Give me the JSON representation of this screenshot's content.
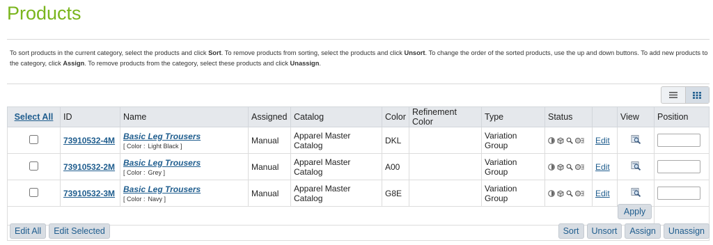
{
  "page_title": "Products",
  "help": {
    "p1": "To sort products in the current category, select the products and click ",
    "sort": "Sort",
    "p2": ". To remove products from sorting, select the products and click ",
    "unsort": "Unsort",
    "p3": ". To change the order of the sorted products, use the up and down buttons. To add new products to the category, click ",
    "assign": "Assign",
    "p4": ". To remove products from the category, select these products and click ",
    "unassign": "Unassign",
    "p5": "."
  },
  "view_toggle": {
    "list_icon": "list-icon",
    "grid_icon": "grid-icon",
    "active": "grid"
  },
  "columns": {
    "select_all": "Select All",
    "id": "ID",
    "name": "Name",
    "assigned": "Assigned",
    "catalog": "Catalog",
    "color": "Color",
    "refinement_color": "Refinement Color",
    "type": "Type",
    "status": "Status",
    "edit": "",
    "view": "View",
    "position": "Position"
  },
  "rows": [
    {
      "id": "73910532-4M",
      "name": "Basic Leg Trousers",
      "attr_label": "[ Color :",
      "attr_value": "Light Black ]",
      "assigned": "Manual",
      "catalog": "Apparel Master Catalog",
      "color": "DKL",
      "refinement_color": "",
      "type": "Variation Group",
      "edit": "Edit",
      "position": ""
    },
    {
      "id": "73910532-2M",
      "name": "Basic Leg Trousers",
      "attr_label": "[ Color :",
      "attr_value": "Grey ]",
      "assigned": "Manual",
      "catalog": "Apparel Master Catalog",
      "color": "A00",
      "refinement_color": "",
      "type": "Variation Group",
      "edit": "Edit",
      "position": ""
    },
    {
      "id": "73910532-3M",
      "name": "Basic Leg Trousers",
      "attr_label": "[ Color :",
      "attr_value": "Navy ]",
      "assigned": "Manual",
      "catalog": "Apparel Master Catalog",
      "color": "G8E",
      "refinement_color": "",
      "type": "Variation Group",
      "edit": "Edit",
      "position": ""
    }
  ],
  "buttons": {
    "apply": "Apply",
    "edit_all": "Edit All",
    "edit_selected": "Edit Selected",
    "sort": "Sort",
    "unsort": "Unsort",
    "assign": "Assign",
    "unassign": "Unassign"
  },
  "colors": {
    "title_green": "#7ab51d",
    "link_blue": "#1f5d8e"
  }
}
